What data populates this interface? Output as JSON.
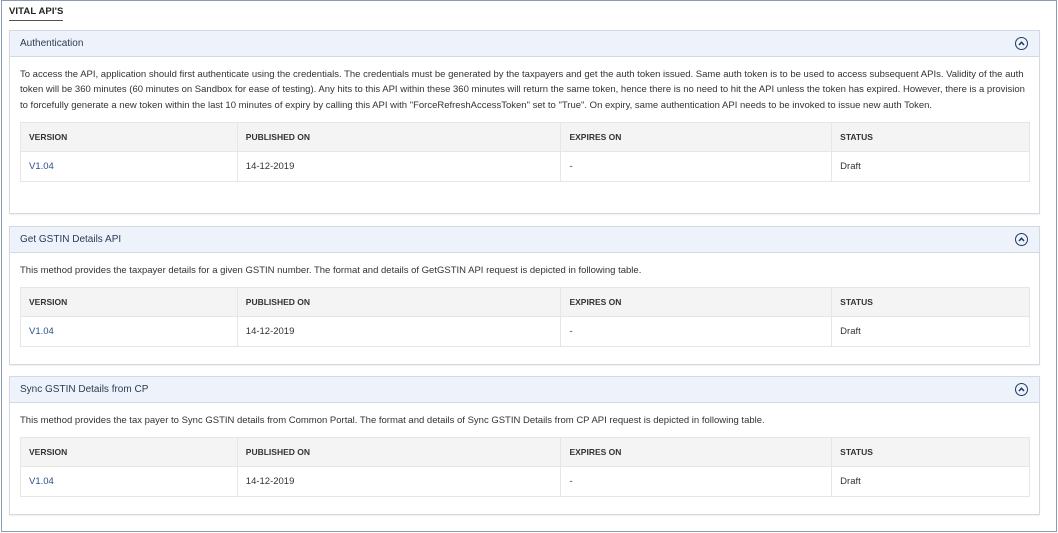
{
  "page": {
    "title": "VITAL API'S"
  },
  "table_headers": [
    "VERSION",
    "PUBLISHED ON",
    "EXPIRES ON",
    "STATUS"
  ],
  "panels": [
    {
      "title": "Authentication",
      "description": "To access the API, application should first authenticate using the credentials. The credentials must be generated by the taxpayers and get the auth token issued. Same auth token is to be used to access subsequent APIs. Validity of the auth token will be 360 minutes (60 minutes on Sandbox for ease of testing). Any hits to this API within these 360 minutes will return the same token, hence there is no need to hit the API unless the token has expired. However, there is a provision to forcefully generate a new token within the last 10 minutes of expiry by calling this API with \"ForceRefreshAccessToken\" set to \"True\". On expiry, same authentication API needs to be invoked to issue new auth Token.",
      "rows": [
        {
          "version": "V1.04",
          "published_on": "14-12-2019",
          "expires_on": "-",
          "status": "Draft"
        }
      ]
    },
    {
      "title": "Get GSTIN Details API",
      "description": "This method provides the taxpayer details for a given GSTIN number. The format and details of GetGSTIN API request is depicted in following table.",
      "rows": [
        {
          "version": "V1.04",
          "published_on": "14-12-2019",
          "expires_on": "-",
          "status": "Draft"
        }
      ]
    },
    {
      "title": "Sync GSTIN Details from CP",
      "description": "This method provides the tax payer to Sync GSTIN details from Common Portal. The format and details of Sync GSTIN Details from CP API request is depicted in following table.",
      "rows": [
        {
          "version": "V1.04",
          "published_on": "14-12-2019",
          "expires_on": "-",
          "status": "Draft"
        }
      ]
    }
  ],
  "icons": {
    "collapse": "chevron-up-circle-icon"
  },
  "colors": {
    "header_bg": "#eef3fb",
    "accent": "#1f3a63",
    "border": "#d3d9e2"
  }
}
